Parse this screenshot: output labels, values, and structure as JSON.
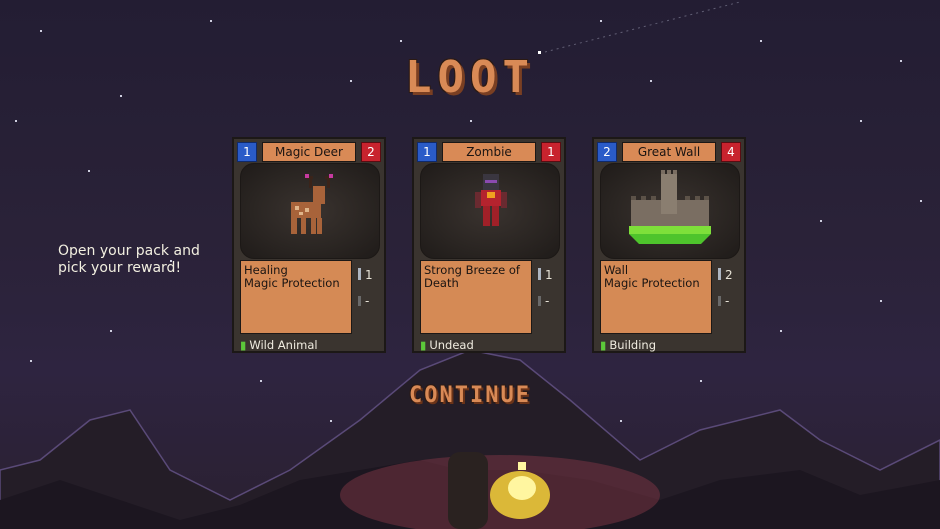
{
  "title": "LOOT",
  "instruction": "Open your pack and pick your reward!",
  "continue_label": "CONTINUE",
  "cards": [
    {
      "cost": "1",
      "name": "Magic Deer",
      "power": "2",
      "description": "Healing\nMagic Protection",
      "stat1": "1",
      "stat2": "-",
      "type": "Wild Animal",
      "art": "deer-icon"
    },
    {
      "cost": "1",
      "name": "Zombie",
      "power": "1",
      "description": "Strong Breeze of Death",
      "stat1": "1",
      "stat2": "-",
      "type": "Undead",
      "art": "zombie-icon"
    },
    {
      "cost": "2",
      "name": "Great Wall",
      "power": "4",
      "description": "Wall\nMagic Protection",
      "stat1": "2",
      "stat2": "-",
      "type": "Building",
      "art": "castle-icon"
    }
  ],
  "colors": {
    "cost_blue": "#2a5bc8",
    "power_red": "#c8232e",
    "card_orange": "#d98a56",
    "type_green": "#5cc83a"
  }
}
